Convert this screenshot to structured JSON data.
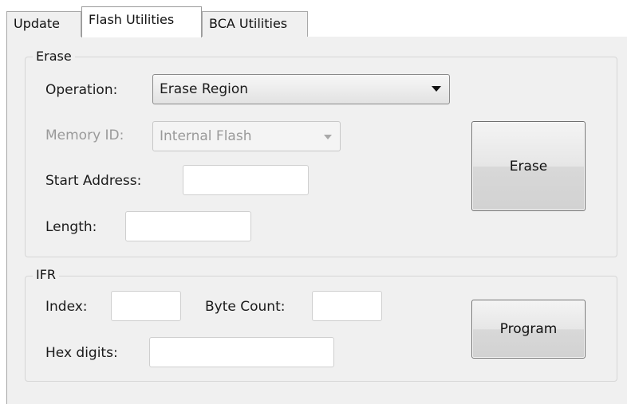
{
  "tabs": [
    {
      "label": "Update"
    },
    {
      "label": "Flash Utilities"
    },
    {
      "label": "BCA Utilities"
    }
  ],
  "active_tab": "Flash Utilities",
  "erase": {
    "title": "Erase",
    "operation_label": "Operation:",
    "operation_value": "Erase Region",
    "memory_id_label": "Memory ID:",
    "memory_id_value": "Internal Flash",
    "memory_id_enabled": false,
    "start_address_label": "Start Address:",
    "start_address_value": "",
    "length_label": "Length:",
    "length_value": "",
    "erase_button": "Erase"
  },
  "ifr": {
    "title": "IFR",
    "index_label": "Index:",
    "index_value": "",
    "byte_count_label": "Byte Count:",
    "byte_count_value": "",
    "hex_digits_label": "Hex digits:",
    "hex_digits_value": "",
    "program_button": "Program"
  },
  "colors": {
    "panel_bg": "#f0f0f0",
    "disabled_text": "#9a9a9a"
  }
}
